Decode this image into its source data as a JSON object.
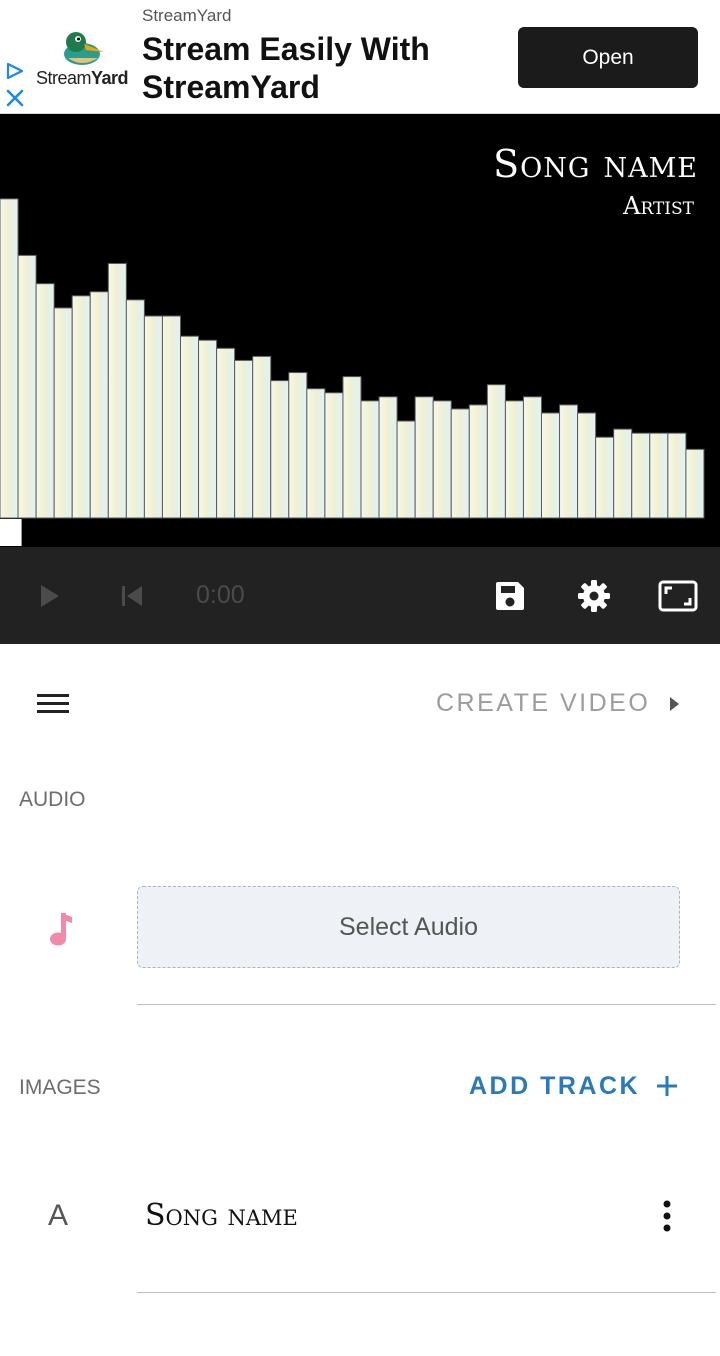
{
  "ad": {
    "source": "StreamYard",
    "headline": "Stream Easily With StreamYard",
    "brand_light": "Stream",
    "brand_bold": "Yard",
    "open_label": "Open",
    "icons": [
      "adchoices-icon",
      "ad-close-icon",
      "streamyard-logo-icon"
    ]
  },
  "visualizer": {
    "song_name": "Song name",
    "artist": "Artist",
    "bar_levels": [
      0.79,
      0.65,
      0.58,
      0.52,
      0.55,
      0.56,
      0.63,
      0.54,
      0.5,
      0.5,
      0.45,
      0.44,
      0.42,
      0.39,
      0.4,
      0.34,
      0.36,
      0.32,
      0.31,
      0.35,
      0.29,
      0.3,
      0.24,
      0.3,
      0.29,
      0.27,
      0.28,
      0.33,
      0.29,
      0.3,
      0.26,
      0.28,
      0.26,
      0.2,
      0.22,
      0.21,
      0.21,
      0.21,
      0.17
    ],
    "progress": 0.03
  },
  "player": {
    "time": "0:00",
    "icons": [
      "play-icon",
      "skip-back-icon",
      "save-icon",
      "settings-icon",
      "fullscreen-icon"
    ]
  },
  "editor": {
    "create_video_label": "CREATE VIDEO",
    "audio_label": "AUDIO",
    "select_audio_label": "Select Audio",
    "images_label": "IMAGES",
    "add_track_label": "ADD TRACK",
    "text_track_badge": "A",
    "text_track_name": "Song name",
    "accent_color": "#2a7ab8",
    "music_icon_color": "#f08aa8"
  }
}
